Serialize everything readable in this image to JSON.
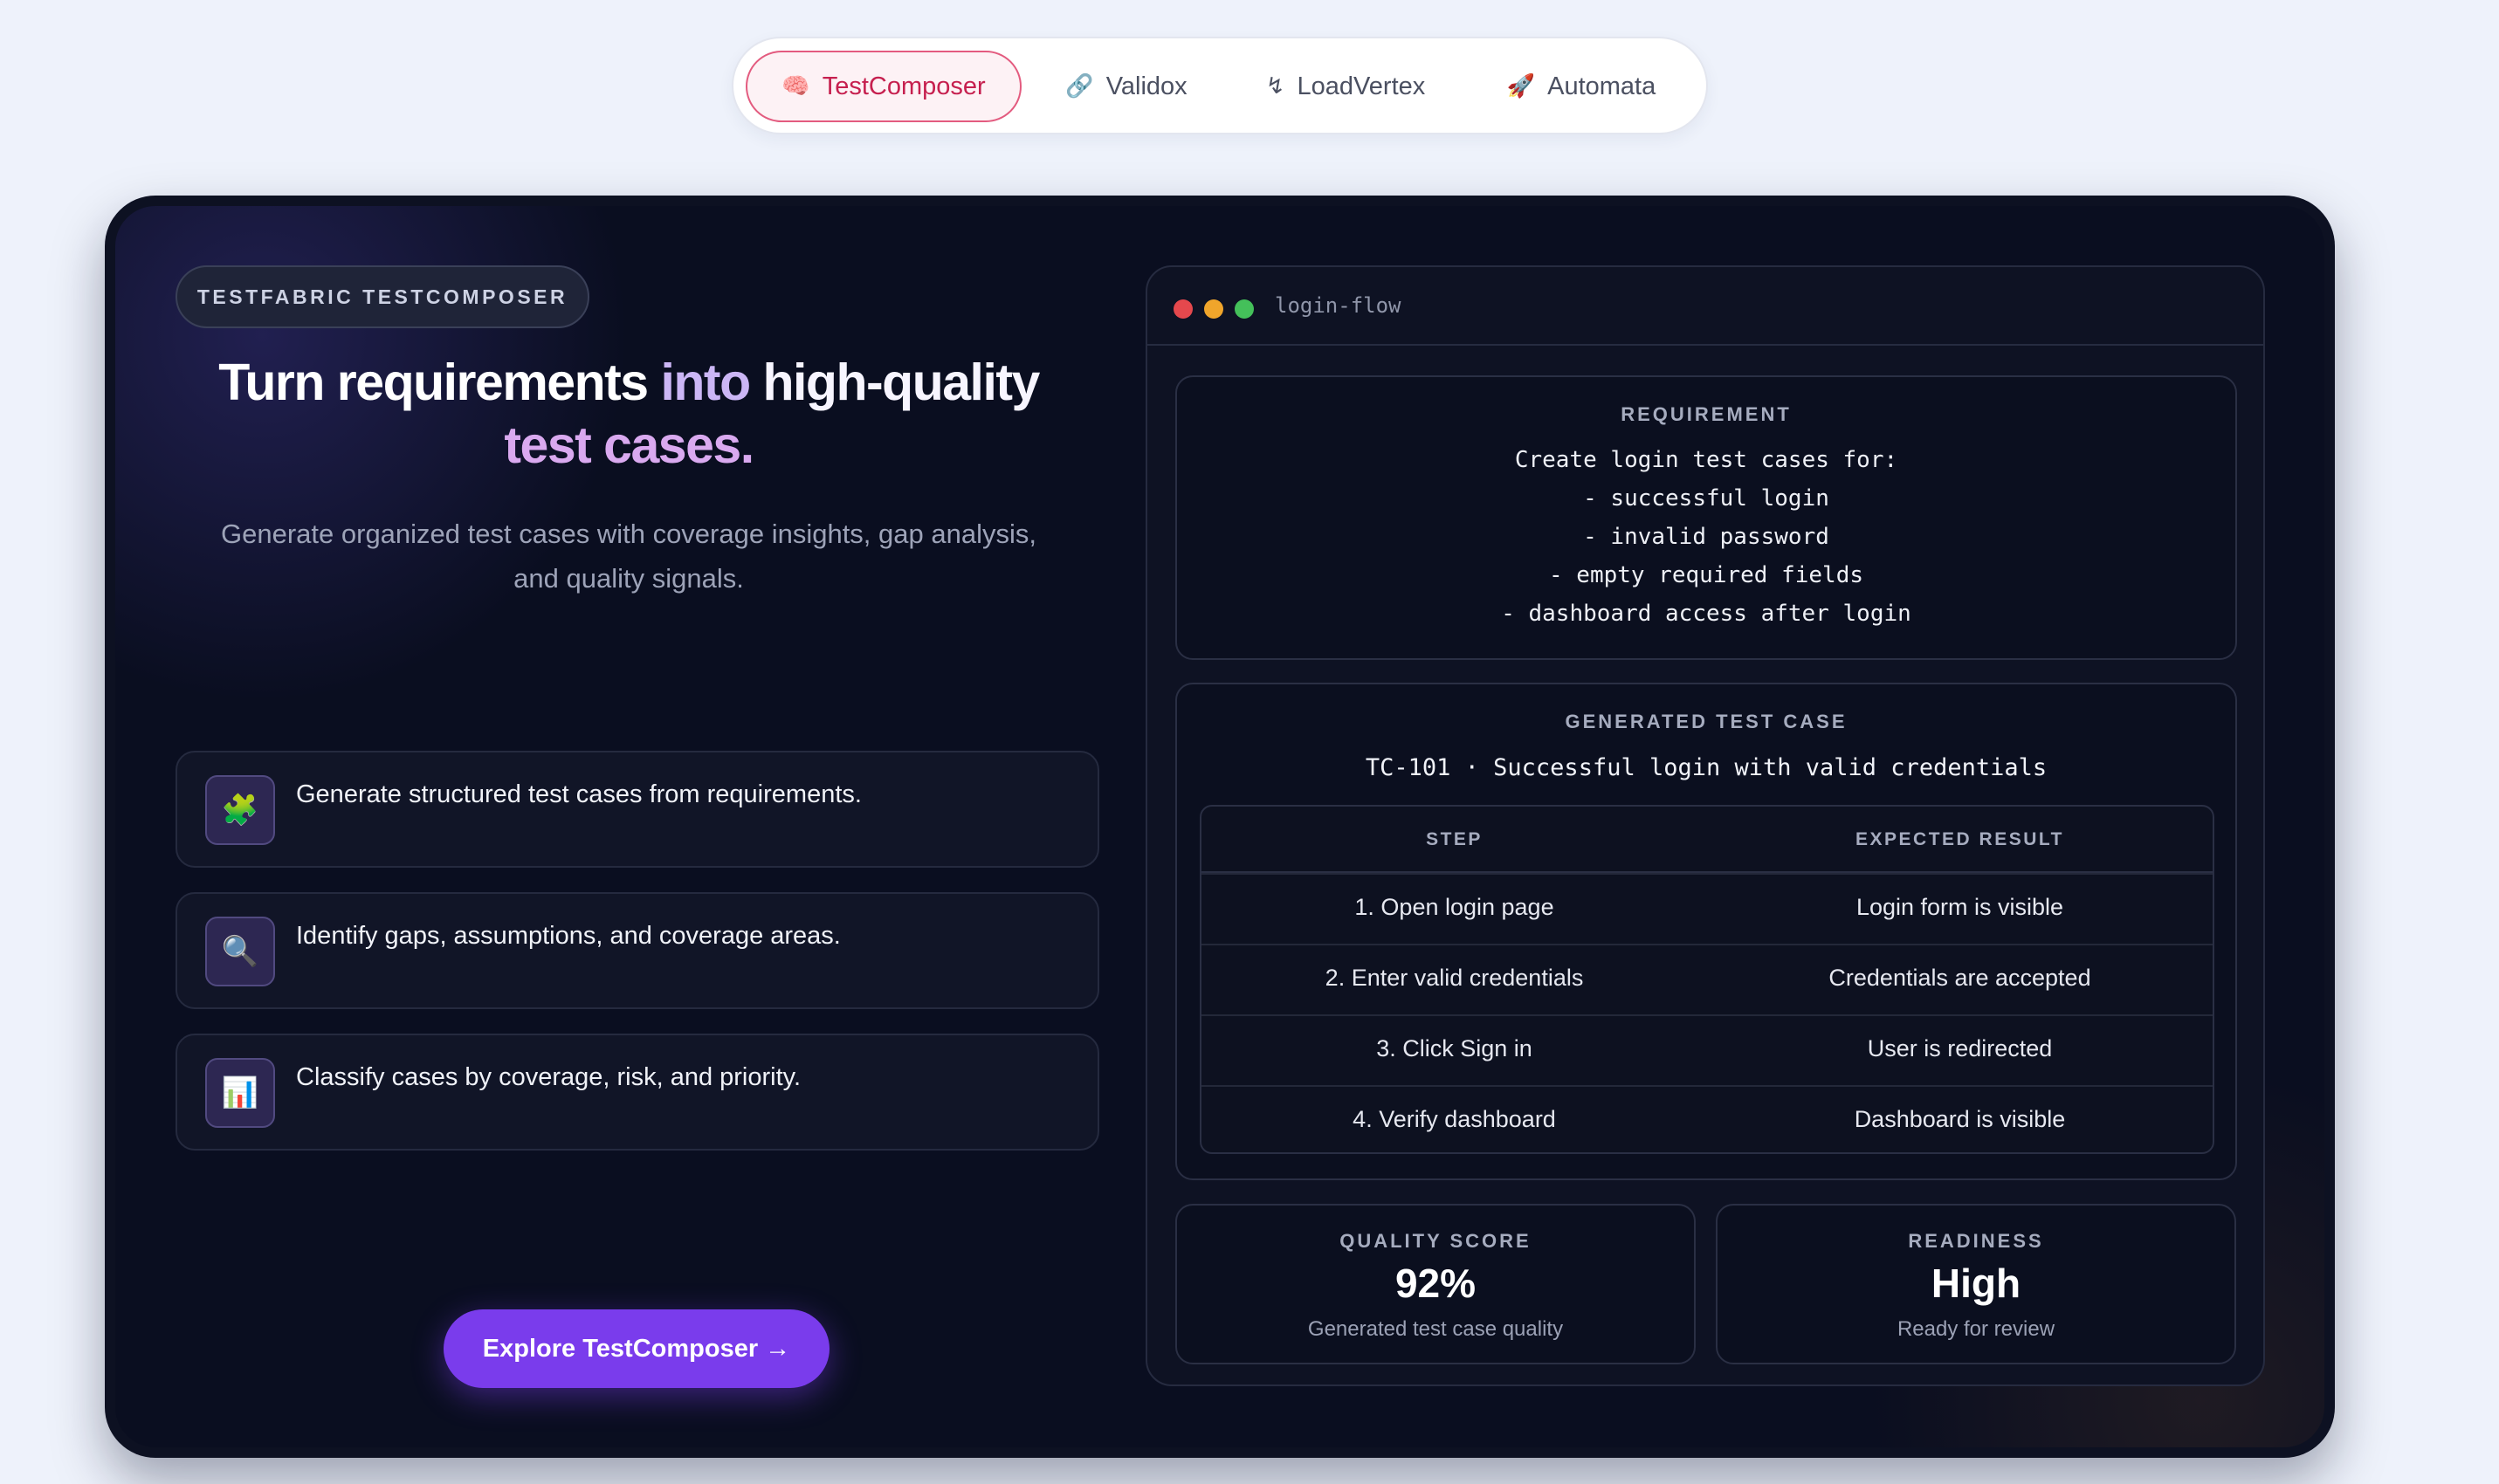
{
  "tabs": [
    {
      "icon": "brain-icon",
      "glyph": "🧠",
      "label": "TestComposer",
      "active": true
    },
    {
      "icon": "link-icon",
      "glyph": "🔗",
      "label": "Validox",
      "active": false
    },
    {
      "icon": "lightning-icon",
      "glyph": "↯",
      "label": "LoadVertex",
      "active": false
    },
    {
      "icon": "rocket-icon",
      "glyph": "🚀",
      "label": "Automata",
      "active": false
    }
  ],
  "hero": {
    "badge": "TESTFABRIC TESTCOMPOSER",
    "headline": {
      "part1": "Turn requirements ",
      "part2": "into ",
      "part3": "high-quality",
      "part4": "test cases."
    },
    "subtitle": "Generate organized test cases with coverage insights, gap analysis, and quality signals.",
    "features": [
      {
        "icon": "puzzle-icon",
        "glyph": "🧩",
        "text": "Generate structured test cases from requirements."
      },
      {
        "icon": "magnifier-icon",
        "glyph": "🔍",
        "text": "Identify gaps, assumptions, and coverage areas."
      },
      {
        "icon": "bar-chart-icon",
        "glyph": "📊",
        "text": "Classify cases by coverage, risk, and priority."
      }
    ],
    "cta_label": "Explore TestComposer →"
  },
  "window": {
    "title": "login-flow",
    "dots": [
      "#e5484d",
      "#f0a52b",
      "#44c05a"
    ],
    "requirement": {
      "label": "REQUIREMENT",
      "lines": [
        "Create login test cases for:",
        "- successful login",
        "- invalid password",
        "- empty required fields",
        "- dashboard access after login"
      ]
    },
    "generated": {
      "label": "GENERATED TEST CASE",
      "title": "TC-101 · Successful login with valid credentials",
      "columns": [
        "STEP",
        "EXPECTED RESULT"
      ],
      "rows": [
        [
          "1. Open login page",
          "Login form is visible"
        ],
        [
          "2. Enter valid credentials",
          "Credentials are accepted"
        ],
        [
          "3. Click Sign in",
          "User is redirected"
        ],
        [
          "4. Verify dashboard",
          "Dashboard is visible"
        ]
      ]
    },
    "stats": [
      {
        "label": "QUALITY SCORE",
        "value": "92%",
        "sub": "Generated test case quality"
      },
      {
        "label": "READINESS",
        "value": "High",
        "sub": "Ready for review"
      }
    ]
  }
}
